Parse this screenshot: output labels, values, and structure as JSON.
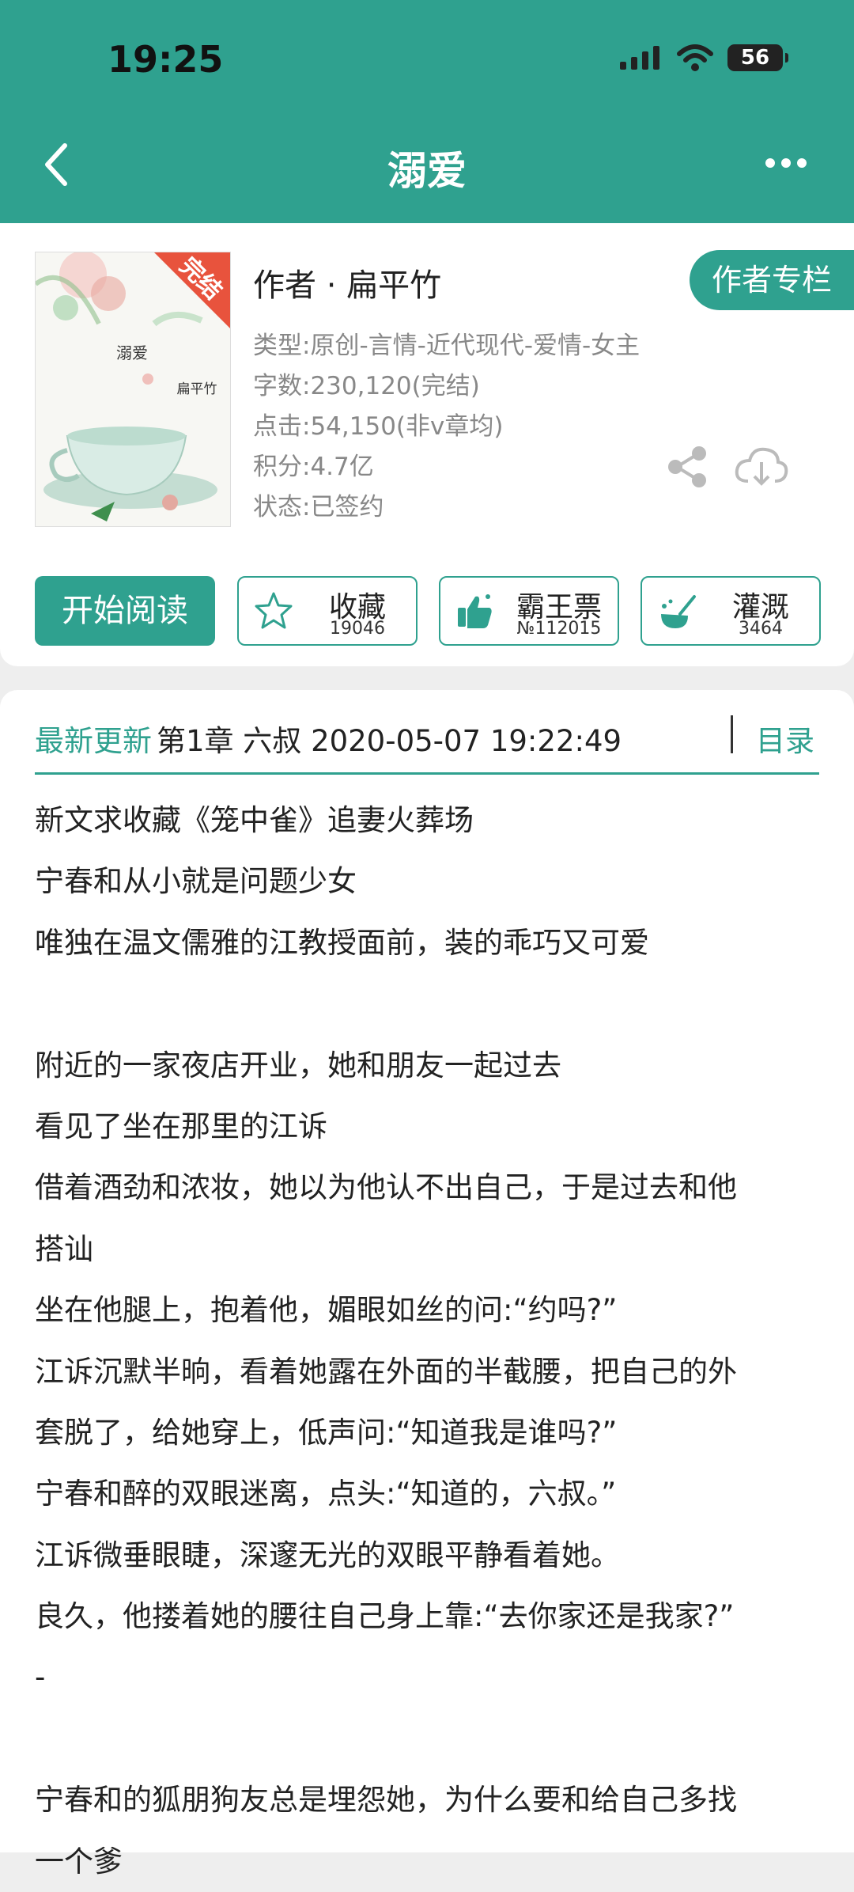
{
  "status_bar": {
    "time": "19:25",
    "battery": "56"
  },
  "header": {
    "title": "溺爱"
  },
  "book": {
    "author_line": "作者 · 扁平竹",
    "author_column_label": "作者专栏",
    "cover": {
      "badge": "完结",
      "title": "溺爱",
      "author": "扁平竹"
    },
    "meta": [
      "类型:原创-言情-近代现代-爱情-女主",
      "字数:230,120(完结)",
      "点击:54,150(非v章均)",
      "积分:4.7亿",
      "状态:已签约"
    ]
  },
  "actions": {
    "start_reading": "开始阅读",
    "collect": {
      "label": "收藏",
      "count": "19046"
    },
    "vote": {
      "label": "霸王票",
      "count": "№112015"
    },
    "nourish": {
      "label": "灌溉",
      "count": "3464"
    }
  },
  "update": {
    "label": "最新更新",
    "chapter": "第1章 六叔 2020-05-07 19:22:49",
    "toc": "目录"
  },
  "synopsis": [
    "新文求收藏《笼中雀》追妻火葬场",
    "宁春和从小就是问题少女",
    "唯独在温文儒雅的江教授面前，装的乖巧又可爱",
    "",
    "附近的一家夜店开业，她和朋友一起过去",
    "看见了坐在那里的江诉",
    "借着酒劲和浓妆，她以为他认不出自己，于是过去和他",
    "搭讪",
    "坐在他腿上，抱着他，媚眼如丝的问:“约吗?”",
    "江诉沉默半晌，看着她露在外面的半截腰，把自己的外",
    "套脱了，给她穿上，低声问:“知道我是谁吗?”",
    "宁春和醉的双眼迷离，点头:“知道的，六叔。”",
    "江诉微垂眼睫，深邃无光的双眼平静看着她。",
    "良久，他搂着她的腰往自己身上靠:“去你家还是我家?”",
    "-",
    "",
    "宁春和的狐朋狗友总是埋怨她，为什么要和给自己多找",
    "一个爹"
  ]
}
